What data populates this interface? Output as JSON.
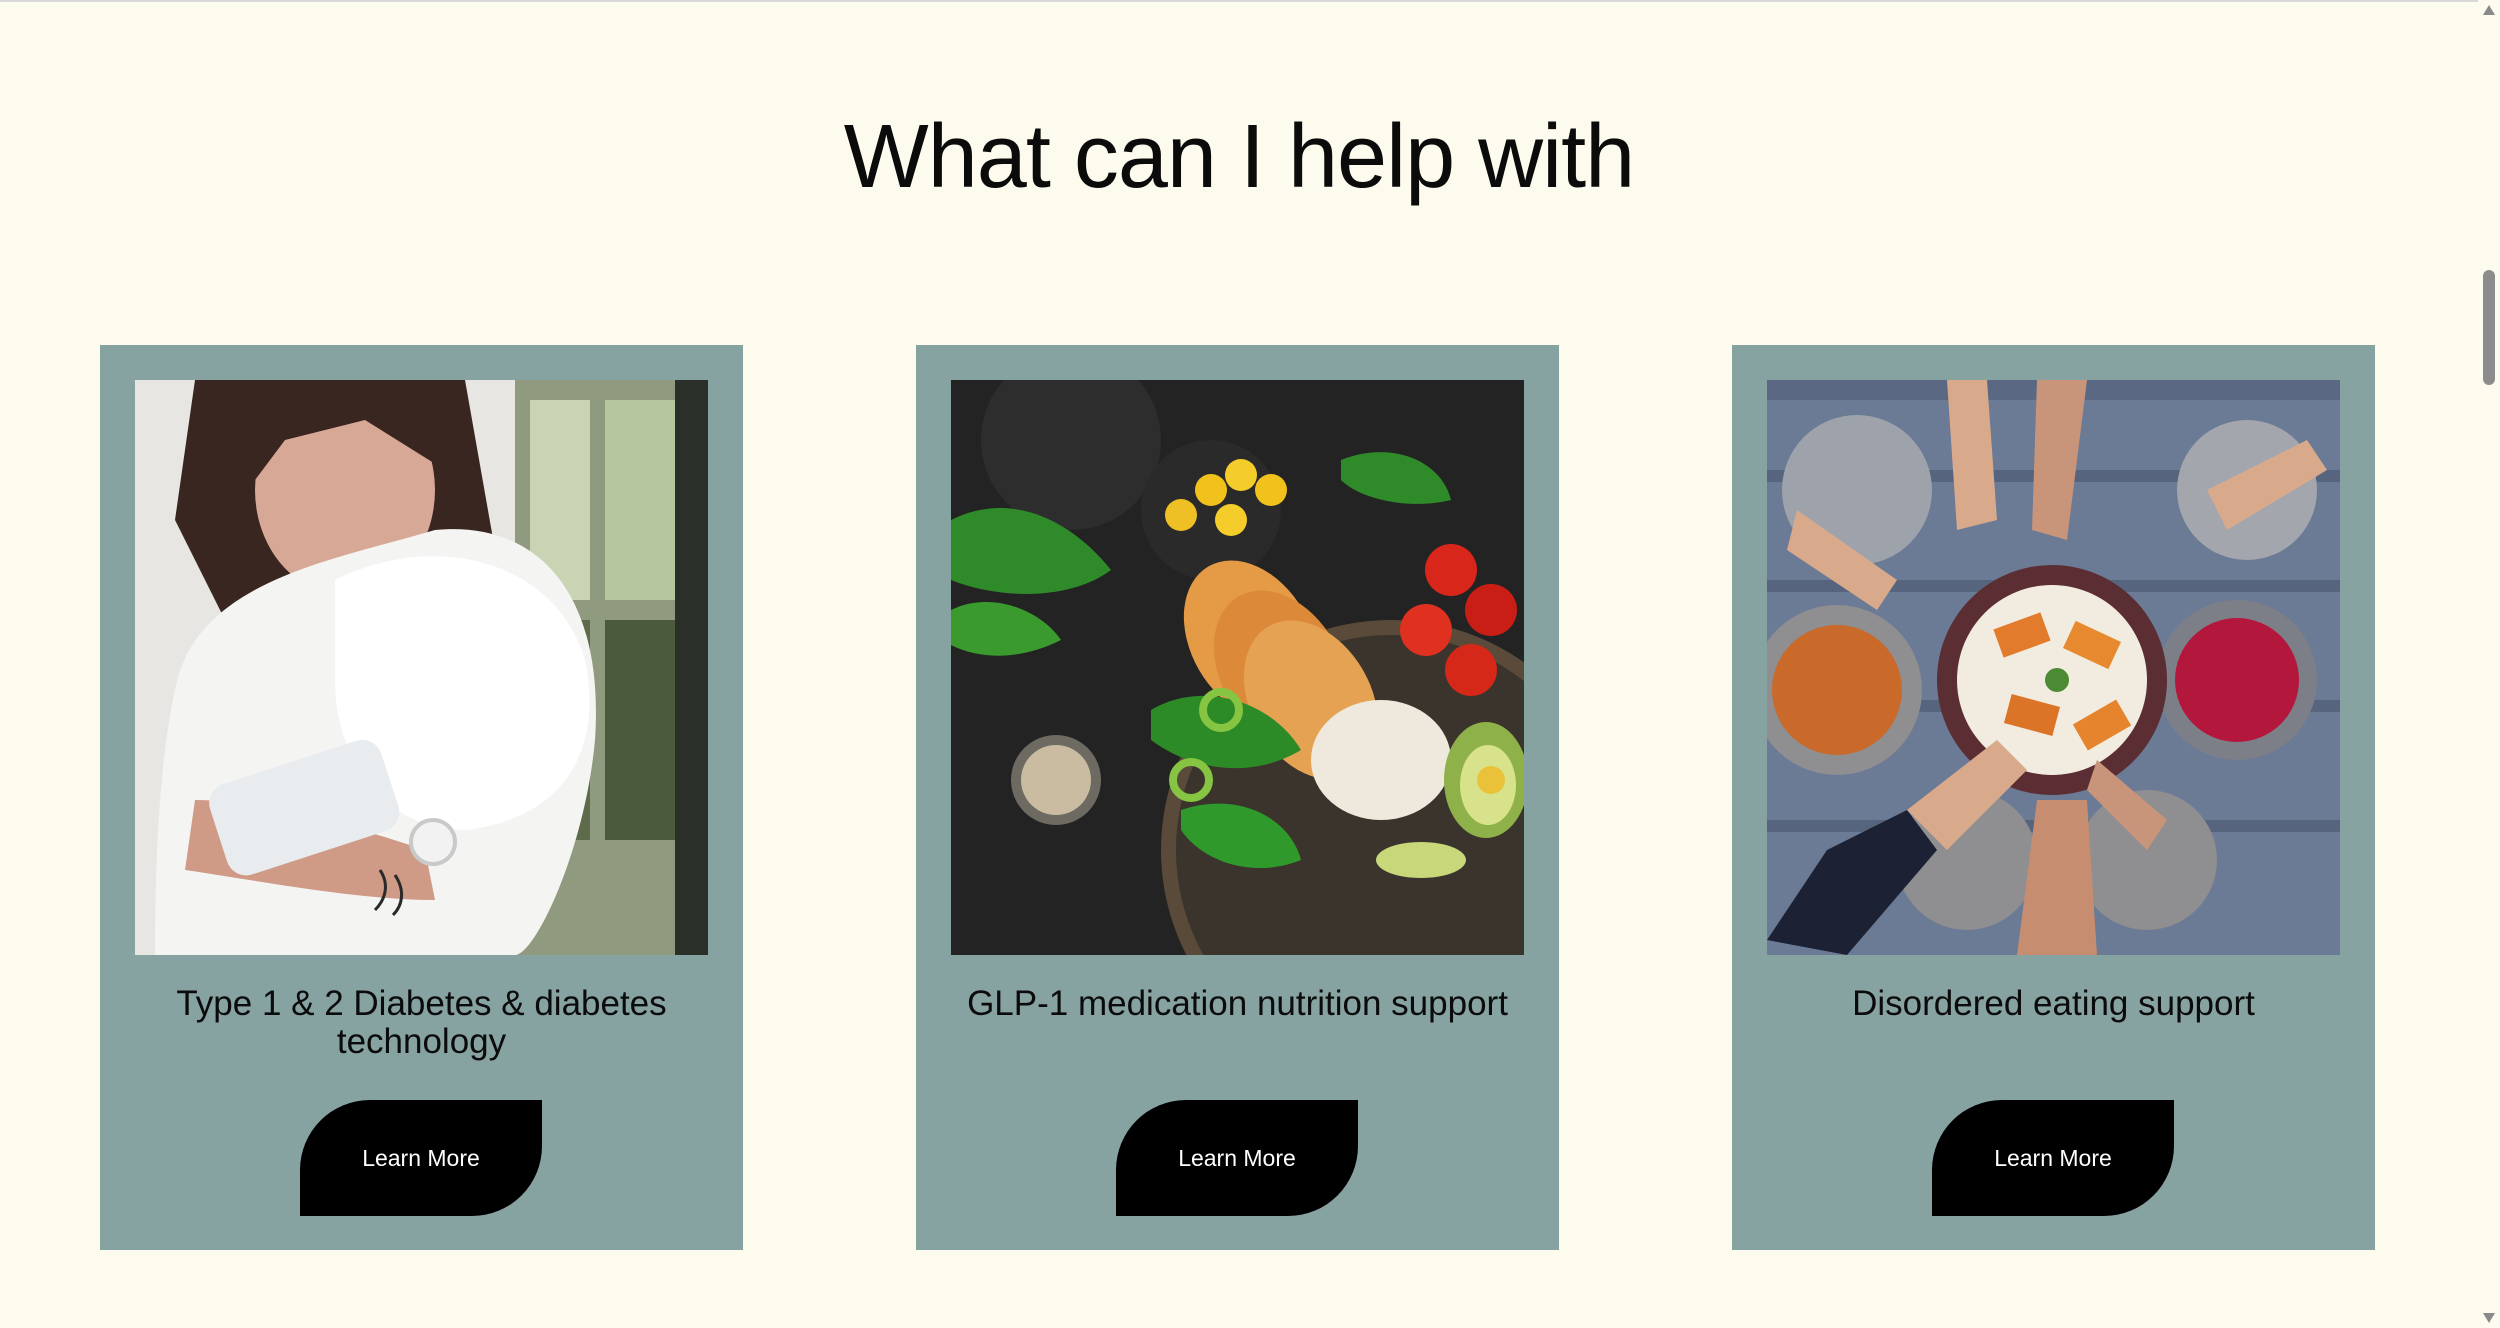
{
  "page": {
    "title": "What can I help with"
  },
  "cards": [
    {
      "title": "Type 1 & 2 Diabetes & diabetes technology",
      "button": "Learn More",
      "image_icon": "woman-with-cgm-sensor-photo"
    },
    {
      "title": "GLP-1 medication nutrition support",
      "button": "Learn More",
      "image_icon": "healthy-bowl-photo"
    },
    {
      "title": "Disordered eating support",
      "button": "Learn More",
      "image_icon": "shared-meal-table-photo"
    }
  ],
  "colors": {
    "background": "#fdfbee",
    "card": "#86a2a1",
    "button": "#000000",
    "button_text": "#ffffff"
  }
}
